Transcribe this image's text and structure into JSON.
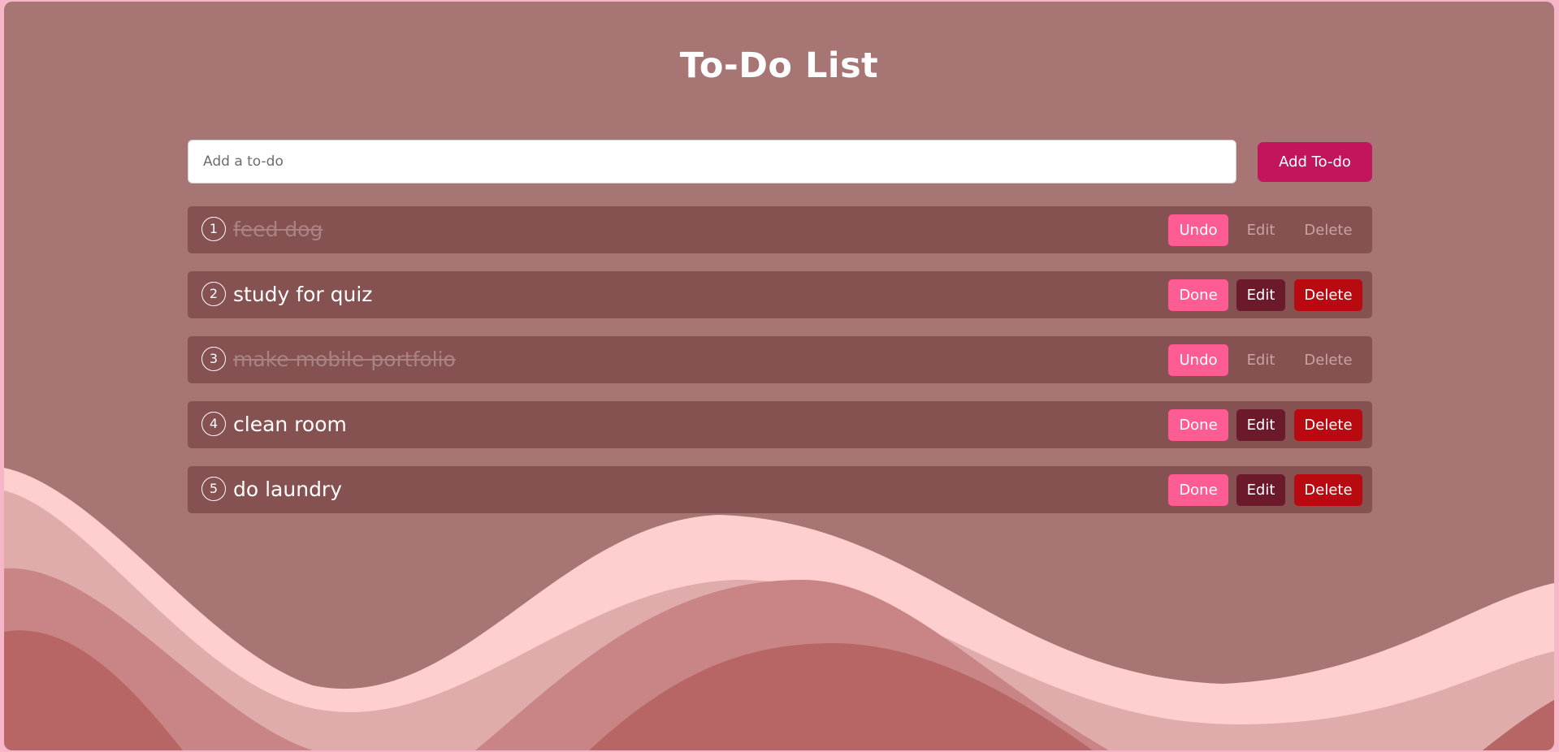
{
  "app": {
    "title": "To-Do List"
  },
  "input": {
    "placeholder": "Add a to-do",
    "value": "",
    "add_label": "Add To-do"
  },
  "todos": [
    {
      "number": "1",
      "text": "feed dog",
      "done": true,
      "toggle_label": "Undo",
      "edit_label": "Edit",
      "delete_label": "Delete"
    },
    {
      "number": "2",
      "text": "study for quiz",
      "done": false,
      "toggle_label": "Done",
      "edit_label": "Edit",
      "delete_label": "Delete"
    },
    {
      "number": "3",
      "text": "make mobile portfolio",
      "done": true,
      "toggle_label": "Undo",
      "edit_label": "Edit",
      "delete_label": "Delete"
    },
    {
      "number": "4",
      "text": "clean room",
      "done": false,
      "toggle_label": "Done",
      "edit_label": "Edit",
      "delete_label": "Delete"
    },
    {
      "number": "5",
      "text": "do laundry",
      "done": false,
      "toggle_label": "Done",
      "edit_label": "Edit",
      "delete_label": "Delete"
    }
  ],
  "colors": {
    "page_background": "#a87575",
    "item_background": "#855151",
    "add_button": "#c2155c",
    "toggle_button": "#ff5c93",
    "edit_button": "#6a1a2a",
    "delete_button": "#b80a10"
  }
}
